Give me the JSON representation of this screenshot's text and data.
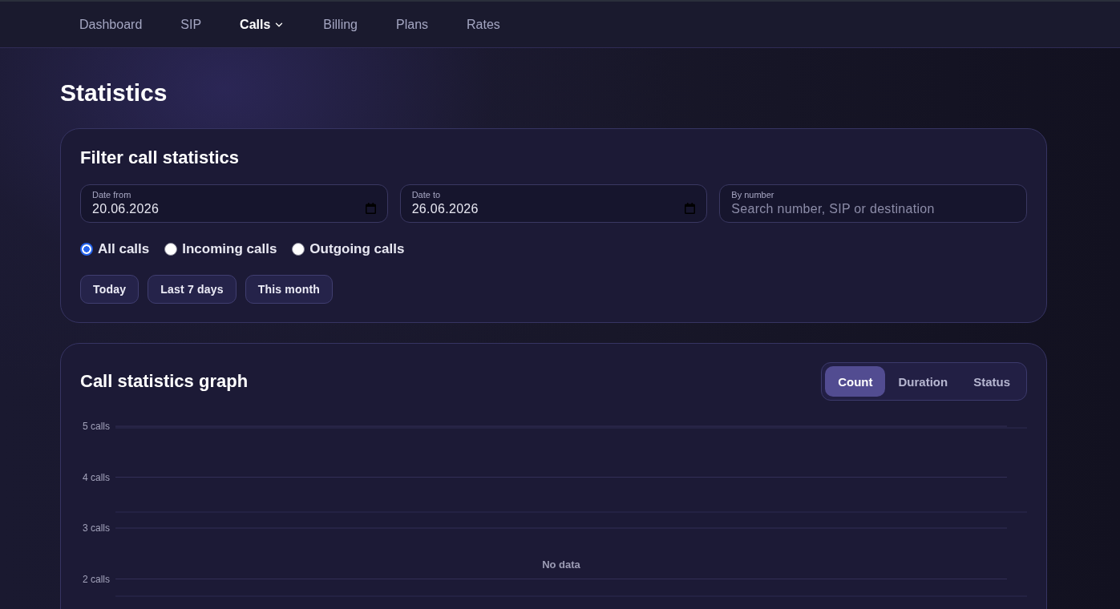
{
  "nav": [
    {
      "label": "Dashboard",
      "selected": false,
      "dropdown": false
    },
    {
      "label": "SIP",
      "selected": false,
      "dropdown": false
    },
    {
      "label": "Calls",
      "selected": true,
      "dropdown": true
    },
    {
      "label": "Billing",
      "selected": false,
      "dropdown": false
    },
    {
      "label": "Plans",
      "selected": false,
      "dropdown": false
    },
    {
      "label": "Rates",
      "selected": false,
      "dropdown": false
    }
  ],
  "page_title": "Statistics",
  "filter": {
    "title": "Filter call statistics",
    "fields": [
      {
        "kind": "date",
        "label": "Date from",
        "value": "20.06.2026"
      },
      {
        "kind": "date",
        "label": "Date to",
        "value": "26.06.2026"
      },
      {
        "kind": "search",
        "label": "By number",
        "placeholder": "Search number, SIP or destination"
      }
    ],
    "call_types": [
      {
        "label": "All calls",
        "selected": true
      },
      {
        "label": "Incoming calls",
        "selected": false
      },
      {
        "label": "Outgoing calls",
        "selected": false
      }
    ],
    "quick_ranges": [
      "Today",
      "Last 7 days",
      "This month"
    ]
  },
  "graph": {
    "title": "Call statistics graph",
    "modes": [
      {
        "label": "Count",
        "selected": true
      },
      {
        "label": "Duration",
        "selected": false
      },
      {
        "label": "Status",
        "selected": false
      }
    ],
    "axis_labels": [
      "5 calls",
      "4 calls",
      "3 calls",
      "2 calls"
    ],
    "empty_message": "No data"
  }
}
